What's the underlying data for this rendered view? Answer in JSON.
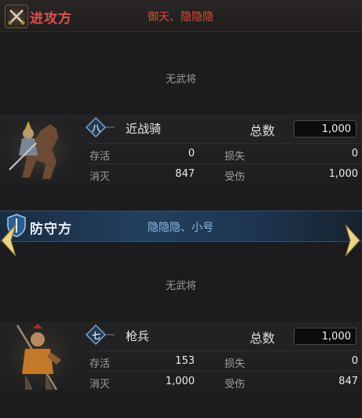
{
  "attacker": {
    "side_label": "进攻方",
    "names": "御天、隐隐隐",
    "no_general": "无武将",
    "unit": {
      "rank": "八",
      "name": "近战骑",
      "total_label": "总数",
      "total": "1,000",
      "stats": {
        "survive_label": "存活",
        "survive": "0",
        "loss_label": "损失",
        "loss": "0",
        "destroy_label": "消灭",
        "destroy": "847",
        "wounded_label": "受伤",
        "wounded": "1,000"
      }
    }
  },
  "defender": {
    "side_label": "防守方",
    "names": "隐隐隐、小号",
    "no_general": "无武将",
    "unit": {
      "rank": "七",
      "name": "枪兵",
      "total_label": "总数",
      "total": "1,000",
      "stats": {
        "survive_label": "存活",
        "survive": "153",
        "loss_label": "损失",
        "loss": "0",
        "destroy_label": "消灭",
        "destroy": "1,000",
        "wounded_label": "受伤",
        "wounded": "847"
      }
    }
  },
  "colors": {
    "attack_accent": "#e05050",
    "defend_accent": "#8fb8e6",
    "arrow_gold": "#e8d48a"
  },
  "icons": [
    "crossed-swords-icon",
    "shield-icon",
    "rank-badge-icon",
    "arrow-left-icon",
    "arrow-right-icon"
  ]
}
